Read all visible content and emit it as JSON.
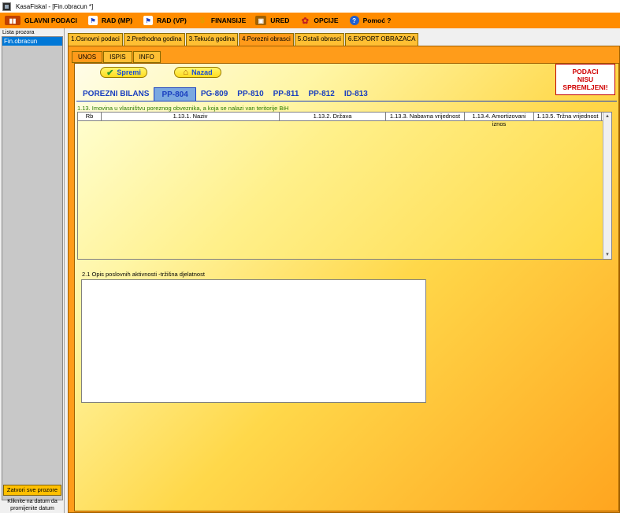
{
  "titlebar": {
    "title": "KasaFiskal  - [Fin.obracun *]"
  },
  "menu": [
    {
      "label": "GLAVNI PODACI",
      "icon": "book-icon",
      "icon_color": "#c04000"
    },
    {
      "label": "RAD (MP)",
      "icon": "flag-icon",
      "icon_color": "#2040c0"
    },
    {
      "label": "RAD (VP)",
      "icon": "flag-icon",
      "icon_color": "#2040c0"
    },
    {
      "label": "FINANSIJE",
      "icon": "money-icon",
      "icon_color": "#e0a000"
    },
    {
      "label": "URED",
      "icon": "box-icon",
      "icon_color": "#a06000"
    },
    {
      "label": "OPCIJE",
      "icon": "gear-icon",
      "icon_color": "#c02020"
    },
    {
      "label": "Pomoć ?",
      "icon": "help-icon",
      "icon_color": "#2060d0"
    }
  ],
  "sidebar": {
    "header": "Lista prozora",
    "items": [
      "Fin.obracun"
    ],
    "close_all_label": "Zatvori sve prozore",
    "hint": "Kliknite na datum da promijenite datum"
  },
  "top_tabs": [
    {
      "label": "1.Osnovni podaci",
      "active": false
    },
    {
      "label": "2.Prethodna godina",
      "active": false
    },
    {
      "label": "3.Tekuća godina",
      "active": false
    },
    {
      "label": "4.Porezni obrasci",
      "active": true
    },
    {
      "label": "5.Ostali obrasci",
      "active": false
    },
    {
      "label": "6.EXPORT OBRAZACA",
      "active": false
    }
  ],
  "inner_tabs": [
    {
      "label": "UNOS",
      "active": true
    },
    {
      "label": "ISPIS",
      "active": false
    },
    {
      "label": "INFO",
      "active": false
    }
  ],
  "buttons": {
    "save": "Spremi",
    "back": "Nazad"
  },
  "warning": {
    "line1": "PODACI",
    "line2": "NISU",
    "line3": "SPREMLJENI!"
  },
  "form_tabs": [
    {
      "label": "POREZNI BILANS",
      "active": false
    },
    {
      "label": "PP-804",
      "active": true
    },
    {
      "label": "PG-809",
      "active": false
    },
    {
      "label": "PP-810",
      "active": false
    },
    {
      "label": "PP-811",
      "active": false
    },
    {
      "label": "PP-812",
      "active": false
    },
    {
      "label": "ID-813",
      "active": false
    }
  ],
  "section1": {
    "label": "1.13. Imovina u vlasništvu poreznog obveznika, a koja se nalazi van teritorije BiH",
    "columns": [
      "Rb",
      "1.13.1. Naziv",
      "1.13.2. Država",
      "1.13.3. Nabavna vrijednost",
      "1.13.4. Amortizovani iznos",
      "1.13.5. Tržna vrijednost"
    ],
    "rows": []
  },
  "section2": {
    "label": "2.1 Opis poslovnih aktivnosti -tržišna djelatnost",
    "value": ""
  },
  "colors": {
    "menubar": "#ff8c00",
    "accent_blue": "#1a3fbf",
    "warning_red": "#d00000"
  }
}
